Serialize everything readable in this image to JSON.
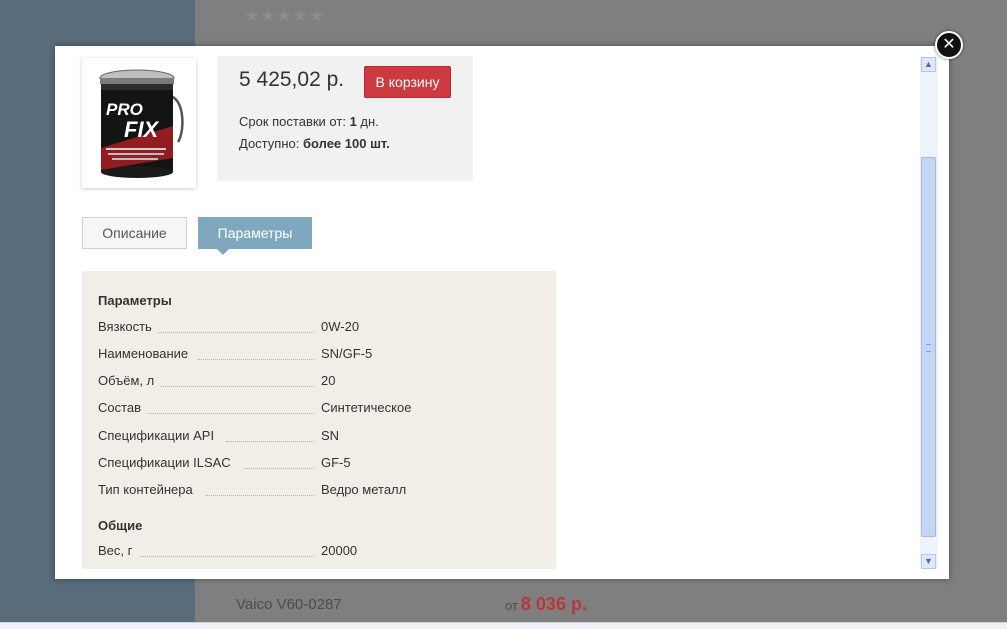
{
  "background": {
    "stars": "★★★★★",
    "product_name": "Vaico V60-0287",
    "price_prefix": "от",
    "price_value": "8 036 р."
  },
  "modal": {
    "close_glyph": "✕",
    "price": "5 425,02 р.",
    "cart_button": "В корзину",
    "delivery_label": "Срок поставки от:",
    "delivery_value": "1",
    "delivery_unit": "дн.",
    "available_label": "Доступно:",
    "available_value": "более 100 шт.",
    "tabs": [
      {
        "label": "Описание",
        "active": false
      },
      {
        "label": "Параметры",
        "active": true
      }
    ],
    "groups": [
      {
        "title": "Параметры",
        "rows": [
          {
            "key": "Вязкость",
            "value": "0W-20"
          },
          {
            "key": "Наименование",
            "value": "SN/GF-5"
          },
          {
            "key": "Объём, л",
            "value": "20"
          },
          {
            "key": "Состав",
            "value": "Синтетическое"
          },
          {
            "key": "Спецификации API",
            "value": "SN"
          },
          {
            "key": "Спецификации ILSAC",
            "value": "GF-5"
          },
          {
            "key": "Тип контейнера",
            "value": "Ведро металл"
          }
        ]
      },
      {
        "title": "Общие",
        "rows": [
          {
            "key": "Вес, г",
            "value": "20000"
          }
        ]
      }
    ],
    "product_image_text": {
      "line1": "PRO",
      "line2": "FIX"
    },
    "scroll_up_glyph": "▲",
    "scroll_down_glyph": "▼"
  },
  "colors": {
    "accent_button": "#cc3a3f",
    "active_tab": "#7fa8bf",
    "background_price": "#b9363d"
  }
}
